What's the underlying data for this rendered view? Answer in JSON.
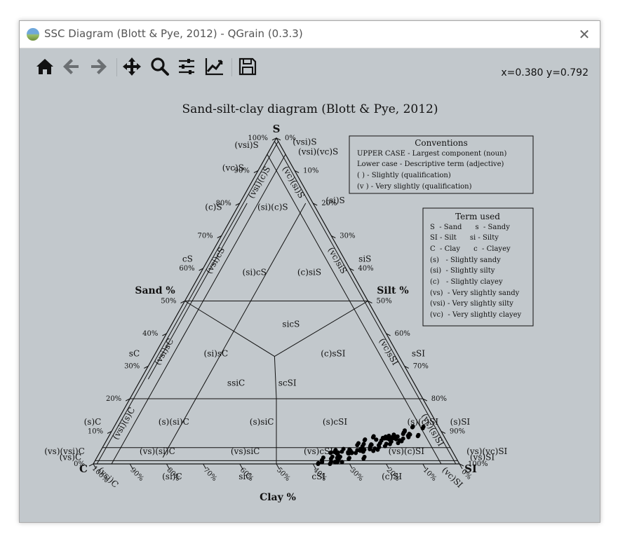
{
  "window": {
    "title": "SSC Diagram (Blott & Pye, 2012) - QGrain (0.3.3)",
    "close_glyph": "✕"
  },
  "toolbar": {
    "buttons": [
      "home-icon",
      "back-icon",
      "forward-icon",
      "pan-icon",
      "zoom-icon",
      "configure-subplots-icon",
      "edit-axis-icon",
      "save-icon"
    ],
    "coords": "x=0.380 y=0.792"
  },
  "chart_data": {
    "type": "scatter",
    "title": "Sand-silt-clay diagram (Blott & Pye, 2012)",
    "vertices": {
      "top": "S",
      "left": "C",
      "right": "SI"
    },
    "axis_labels": {
      "sand": "Sand %",
      "silt": "Silt %",
      "clay": "Clay %"
    },
    "sand_ticks": [
      "100%",
      "90%",
      "80%",
      "70%",
      "60%",
      "50%",
      "40%",
      "30%",
      "20%",
      "10%",
      "0%"
    ],
    "silt_ticks": [
      "0%",
      "10%",
      "20%",
      "30%",
      "40%",
      "50%",
      "60%",
      "70%",
      "80%",
      "90%",
      "100%"
    ],
    "clay_ticks": [
      "100%",
      "90%",
      "80%",
      "70%",
      "60%",
      "50%",
      "40%",
      "30%",
      "20%",
      "10%",
      "0%"
    ],
    "outer_labels": {
      "left": [
        "(vsi)S",
        "(vc)S",
        "(c)S",
        "cS",
        "sC",
        "(s)C",
        "(vs)(vsi)C",
        "(vs)C"
      ],
      "right": [
        "(vsi)S",
        "(vsi)(vc)S",
        "(si)S",
        "siS",
        "sSI",
        "(s)SI",
        "(vs)(vc)SI",
        "(vs)SI"
      ],
      "bottom": [
        "(vsi)C",
        "(si)C",
        "siC",
        "cSI",
        "(c)SI",
        "(vc)SI"
      ]
    },
    "strip_labels": [
      "(vsi)(c)S",
      "(vc)(si)S",
      "(vsi)cS",
      "(vc)siS",
      "(vsi)sC",
      "(vc)sSI",
      "(vsi)(s)C",
      "(vc)(s)SI",
      "(vs)(si)C",
      "(vs)siC",
      "(vs)cSI",
      "(vs)(c)SI"
    ],
    "region_labels": [
      "(si)(c)S",
      "(si)cS",
      "(c)siS",
      "sicS",
      "(si)sC",
      "(c)sSI",
      "ssiC",
      "scSI",
      "(s)(si)C",
      "(s)siC",
      "(s)cSI",
      "(s)(c)SI"
    ],
    "conventions": {
      "title": "Conventions",
      "lines": [
        "UPPER CASE - Largest component (noun)",
        "Lower case - Descriptive term (adjective)",
        "( ) - Slightly (qualification)",
        "(v ) - Very slightly (qualification)"
      ]
    },
    "terms": {
      "title": "Term used",
      "lines": [
        "S  - Sand      s  - Sandy",
        "SI - Silt      si - Silty",
        "C  - Clay      c  - Clayey",
        "(s)   - Slightly sandy",
        "(si)  - Slightly silty",
        "(c)   - Slightly clayey",
        "(vs)  - Very slightly sandy",
        "(vsi) - Very slightly silty",
        "(vc)  - Very slightly clayey"
      ]
    },
    "points": {
      "sand": [
        0.09,
        0.08,
        0.07,
        0.06,
        0.05,
        0.04,
        0.03,
        0.02,
        0.1,
        0.07,
        0.05,
        0.03,
        0.02,
        0.01
      ],
      "silt_center": [
        0.8,
        0.77,
        0.74,
        0.72,
        0.7,
        0.68,
        0.66,
        0.64,
        0.83,
        0.79,
        0.75,
        0.71,
        0.67,
        0.63
      ]
    }
  }
}
